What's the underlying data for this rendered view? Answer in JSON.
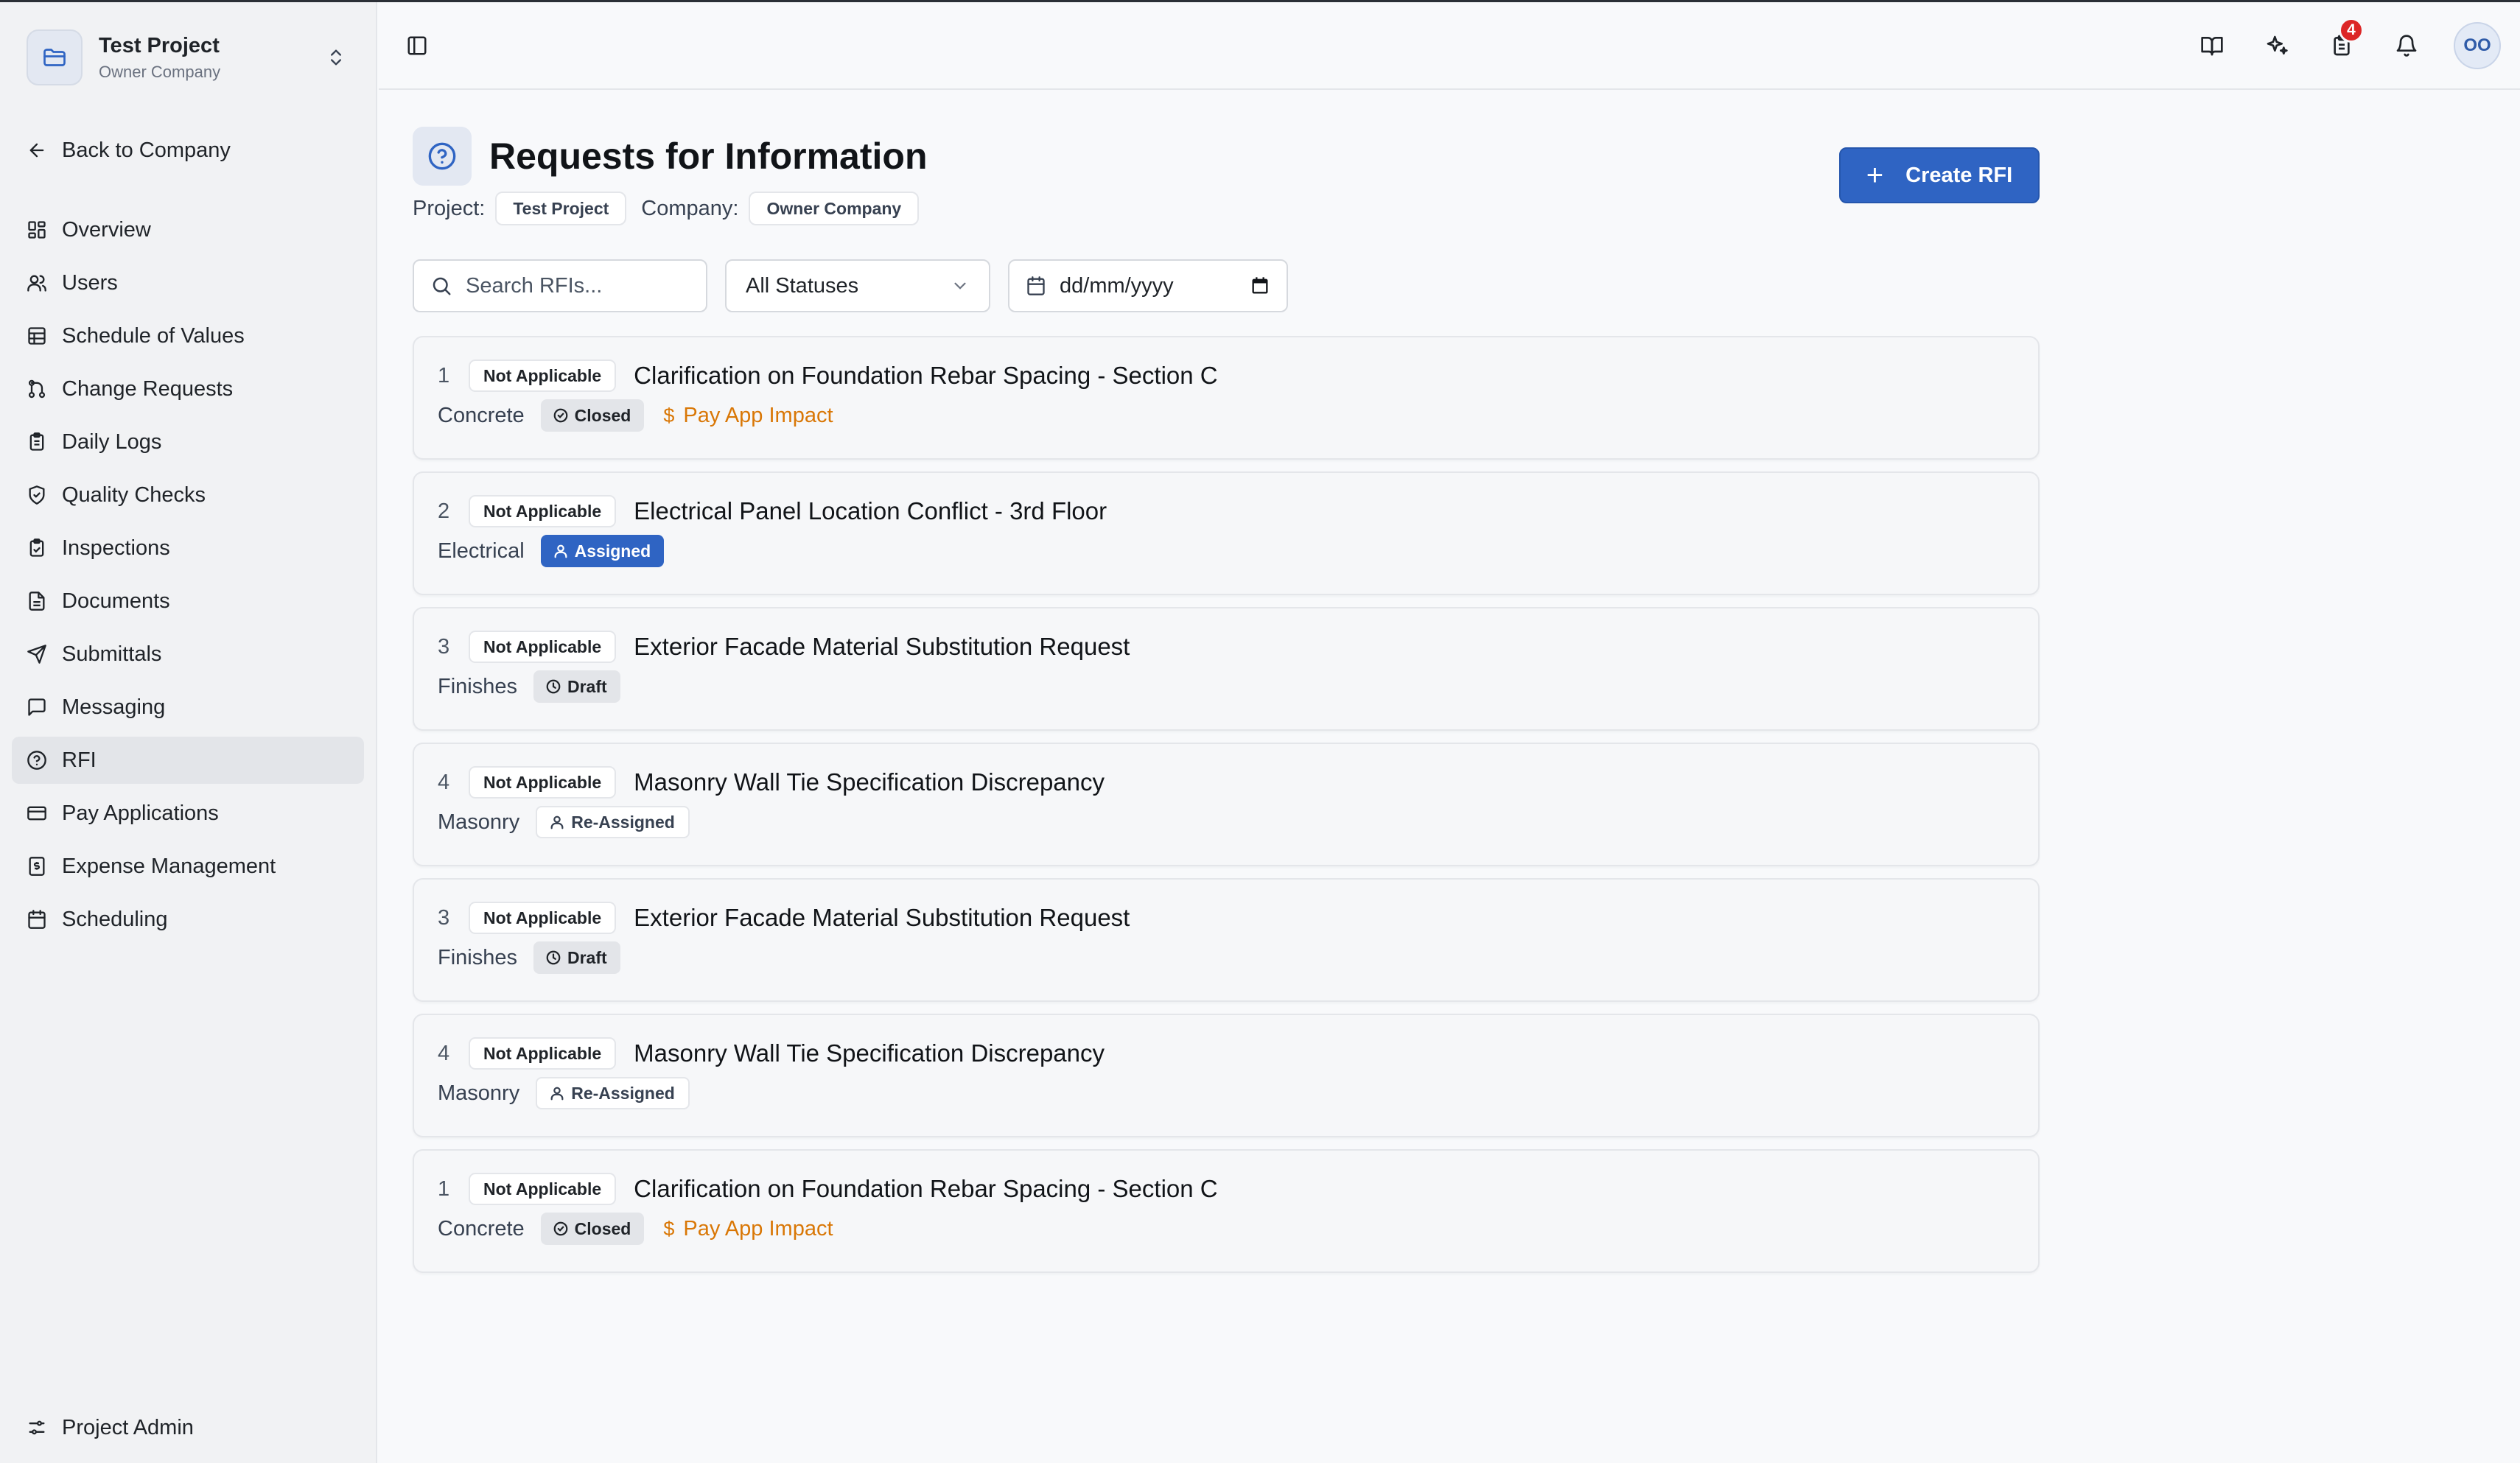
{
  "project": {
    "name": "Test Project",
    "company": "Owner Company"
  },
  "sidebar": {
    "back_label": "Back to Company",
    "items": [
      {
        "label": "Overview",
        "icon": "grid-icon",
        "active": false
      },
      {
        "label": "Users",
        "icon": "users-icon",
        "active": false
      },
      {
        "label": "Schedule of Values",
        "icon": "table-icon",
        "active": false
      },
      {
        "label": "Change Requests",
        "icon": "git-branch-icon",
        "active": false
      },
      {
        "label": "Daily Logs",
        "icon": "clipboard-icon",
        "active": false
      },
      {
        "label": "Quality Checks",
        "icon": "shield-check-icon",
        "active": false
      },
      {
        "label": "Inspections",
        "icon": "clipboard-check-icon",
        "active": false
      },
      {
        "label": "Documents",
        "icon": "file-text-icon",
        "active": false
      },
      {
        "label": "Submittals",
        "icon": "send-icon",
        "active": false
      },
      {
        "label": "Messaging",
        "icon": "message-square-icon",
        "active": false
      },
      {
        "label": "RFI",
        "icon": "help-circle-icon",
        "active": true
      },
      {
        "label": "Pay Applications",
        "icon": "credit-card-icon",
        "active": false
      },
      {
        "label": "Expense Management",
        "icon": "receipt-icon",
        "active": false
      },
      {
        "label": "Scheduling",
        "icon": "calendar-icon",
        "active": false
      }
    ],
    "footer_label": "Project Admin"
  },
  "topbar": {
    "notification_count": "4",
    "avatar_initials": "OO"
  },
  "header": {
    "title": "Requests for Information",
    "project_label": "Project:",
    "project_value": "Test Project",
    "company_label": "Company:",
    "company_value": "Owner Company",
    "create_button": "Create RFI"
  },
  "filters": {
    "search_placeholder": "Search RFIs...",
    "status_value": "All Statuses",
    "date_placeholder": "dd/mm/yyyy"
  },
  "rfis": [
    {
      "number": "1",
      "applicability": "Not Applicable",
      "title": "Clarification on Foundation Rebar Spacing - Section C",
      "category": "Concrete",
      "status": "Closed",
      "status_type": "closed",
      "pay_impact": "Pay App Impact"
    },
    {
      "number": "2",
      "applicability": "Not Applicable",
      "title": "Electrical Panel Location Conflict - 3rd Floor",
      "category": "Electrical",
      "status": "Assigned",
      "status_type": "assigned",
      "pay_impact": ""
    },
    {
      "number": "3",
      "applicability": "Not Applicable",
      "title": "Exterior Facade Material Substitution Request",
      "category": "Finishes",
      "status": "Draft",
      "status_type": "draft",
      "pay_impact": ""
    },
    {
      "number": "4",
      "applicability": "Not Applicable",
      "title": "Masonry Wall Tie Specification Discrepancy",
      "category": "Masonry",
      "status": "Re-Assigned",
      "status_type": "reassigned",
      "pay_impact": ""
    },
    {
      "number": "3",
      "applicability": "Not Applicable",
      "title": "Exterior Facade Material Substitution Request",
      "category": "Finishes",
      "status": "Draft",
      "status_type": "draft",
      "pay_impact": ""
    },
    {
      "number": "4",
      "applicability": "Not Applicable",
      "title": "Masonry Wall Tie Specification Discrepancy",
      "category": "Masonry",
      "status": "Re-Assigned",
      "status_type": "reassigned",
      "pay_impact": ""
    },
    {
      "number": "1",
      "applicability": "Not Applicable",
      "title": "Clarification on Foundation Rebar Spacing - Section C",
      "category": "Concrete",
      "status": "Closed",
      "status_type": "closed",
      "pay_impact": "Pay App Impact"
    }
  ],
  "colors": {
    "primary": "#2f64c3",
    "pay_impact": "#d97706",
    "badge": "#dc2626"
  }
}
